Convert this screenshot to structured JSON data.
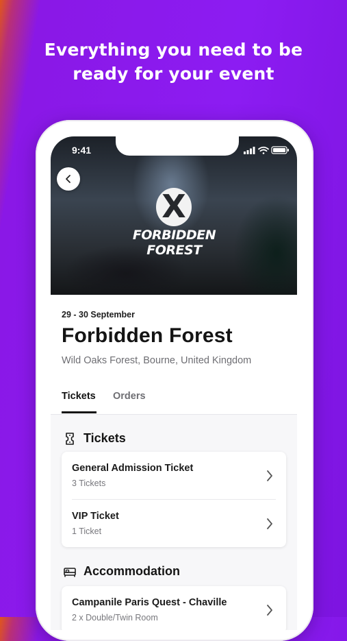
{
  "headline": {
    "line1": "Everything you need to be",
    "line2": "ready for your event"
  },
  "status_bar": {
    "time": "9:41",
    "icons": [
      "signal-icon",
      "wifi-icon",
      "battery-icon"
    ]
  },
  "hero": {
    "back_icon": "chevron-left-icon",
    "logo_mark": "X",
    "logo_text_line1": "FORBIDDEN",
    "logo_text_line2": "FOREST"
  },
  "event": {
    "date": "29 - 30 September",
    "title": "Forbidden Forest",
    "location": "Wild Oaks Forest, Bourne, United Kingdom"
  },
  "tabs": [
    {
      "label": "Tickets",
      "active": true
    },
    {
      "label": "Orders",
      "active": false
    }
  ],
  "tickets_section": {
    "heading": "Tickets",
    "icon": "ticket-icon",
    "items": [
      {
        "name": "General Admission Ticket",
        "detail": "3 Tickets"
      },
      {
        "name": "VIP Ticket",
        "detail": "1 Ticket"
      }
    ]
  },
  "accommodation_section": {
    "heading": "Accommodation",
    "icon": "bed-icon",
    "items": [
      {
        "name": "Campanile Paris Quest - Chaville",
        "detail": "2 x Double/Twin Room"
      }
    ]
  },
  "colors": {
    "background_purple": "#8c1cf2",
    "background_orange_edge": "#e0561c",
    "text_primary": "#141414",
    "text_secondary": "#6e6e73"
  }
}
